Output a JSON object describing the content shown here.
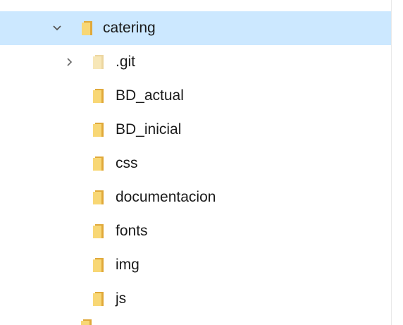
{
  "tree": {
    "root": {
      "label": "catering",
      "expanded": true,
      "selected": true,
      "icon": "folder-icon",
      "chevron_icon": "chevron-down-icon"
    },
    "children": [
      {
        "label": ".git",
        "expandable": true,
        "faded": true,
        "icon": "folder-icon",
        "chevron_icon": "chevron-right-icon"
      },
      {
        "label": "BD_actual",
        "icon": "folder-icon"
      },
      {
        "label": "BD_inicial",
        "icon": "folder-icon"
      },
      {
        "label": "css",
        "icon": "folder-icon"
      },
      {
        "label": "documentacion",
        "icon": "folder-icon"
      },
      {
        "label": "fonts",
        "icon": "folder-icon"
      },
      {
        "label": "img",
        "icon": "folder-icon"
      },
      {
        "label": "js",
        "icon": "folder-icon"
      }
    ]
  },
  "colors": {
    "selection_bg": "#cce8ff",
    "folder_body": "#f8d775",
    "folder_back": "#e0a93a",
    "folder_faded": "#f7e7b8",
    "chevron": "#555555",
    "text": "#1a1a1a"
  }
}
